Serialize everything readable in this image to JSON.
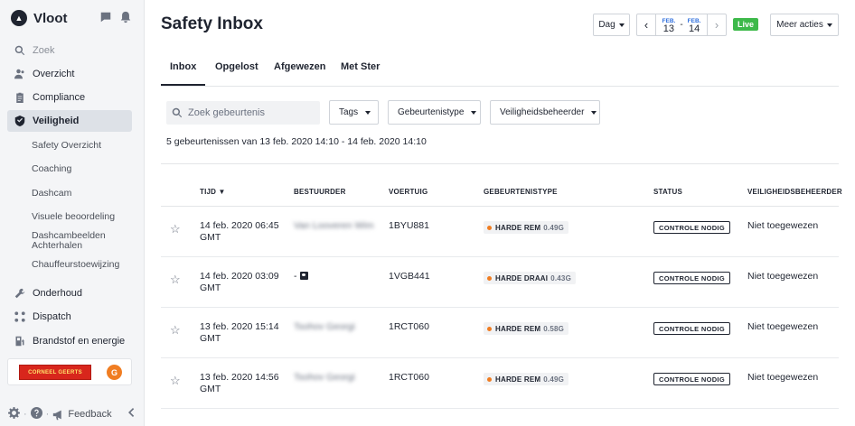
{
  "app": {
    "name": "Vloot"
  },
  "sidebar": {
    "search_label": "Zoek",
    "items": [
      {
        "label": "Overzicht",
        "icon": "people-icon"
      },
      {
        "label": "Compliance",
        "icon": "clipboard-icon"
      },
      {
        "label": "Veiligheid",
        "icon": "shield-icon"
      },
      {
        "label": "Onderhoud",
        "icon": "wrench-icon"
      },
      {
        "label": "Dispatch",
        "icon": "route-icon"
      },
      {
        "label": "Brandstof en energie",
        "icon": "fuel-icon"
      }
    ],
    "subitems": [
      "Safety Overzicht",
      "Coaching",
      "Dashcam",
      "Visuele beoordeling",
      "Dashcambeelden Achterhalen",
      "Chauffeurstoewijzing"
    ],
    "org_logo": "CORNEEL GEERTS",
    "org_initial": "G",
    "feedback_label": "Feedback"
  },
  "header": {
    "title": "Safety Inbox",
    "period_label": "Dag",
    "date_from": {
      "month": "FEB.",
      "day": "13"
    },
    "date_to": {
      "month": "FEB.",
      "day": "14"
    },
    "date_sep": "-",
    "live_label": "Live",
    "more_actions_label": "Meer acties"
  },
  "tabs": [
    "Inbox",
    "Opgelost",
    "Afgewezen",
    "Met Ster"
  ],
  "filters": {
    "search_placeholder": "Zoek gebeurtenis",
    "tags": "Tags",
    "event_type": "Gebeurtenistype",
    "safety_manager": "Veiligheidsbeheerder"
  },
  "summary": "5 gebeurtenissen van 13 feb. 2020 14:10 - 14 feb. 2020 14:10",
  "table": {
    "columns": [
      "TIJD ▼",
      "BESTUURDER",
      "VOERTUIG",
      "GEBEURTENISTYPE",
      "STATUS",
      "VEILIGHEIDSBEHEERDER"
    ],
    "rows": [
      {
        "time": "14 feb. 2020 06:45 GMT",
        "driver": "Van Looveren Wim",
        "vehicle": "1BYU881",
        "type": "HARDE REM",
        "g": "0.49G",
        "status": "CONTROLE NODIG",
        "manager": "Niet toegewezen"
      },
      {
        "time": "14 feb. 2020 03:09 GMT",
        "driver": "-",
        "vehicle": "1VGB441",
        "type": "HARDE DRAAI",
        "g": "0.43G",
        "status": "CONTROLE NODIG",
        "manager": "Niet toegewezen"
      },
      {
        "time": "13 feb. 2020 15:14 GMT",
        "driver": "Tsohov Georgi",
        "vehicle": "1RCT060",
        "type": "HARDE REM",
        "g": "0.58G",
        "status": "CONTROLE NODIG",
        "manager": "Niet toegewezen"
      },
      {
        "time": "13 feb. 2020 14:56 GMT",
        "driver": "Tsohov Georgi",
        "vehicle": "1RCT060",
        "type": "HARDE REM",
        "g": "0.49G",
        "status": "CONTROLE NODIG",
        "manager": "Niet toegewezen"
      }
    ]
  },
  "colors": {
    "accent": "#2f6fde",
    "live": "#3db94a",
    "event_dot": "#f07d22",
    "sidebar_bg": "#f4f5f7"
  }
}
